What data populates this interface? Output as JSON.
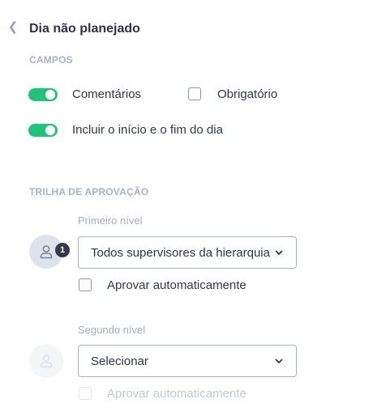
{
  "header": {
    "back_icon": "chevron-left-icon",
    "title": "Dia não planejado"
  },
  "campos": {
    "section_label": "CAMPOS",
    "comentarios": {
      "label": "Comentários",
      "toggle_on": true
    },
    "obrigatorio": {
      "label": "Obrigatório",
      "checked": false
    },
    "incluir": {
      "label": "Incluir o início e o fim do dia",
      "toggle_on": true
    }
  },
  "trilha": {
    "section_label": "TRILHA DE APROVAÇÃO",
    "levels": [
      {
        "label": "Primeiro nível",
        "badge": "1",
        "avatar_icon": "user-icon",
        "select_value": "Todos supervisores da hierarquia",
        "auto_approve_label": "Aprovar automaticamente",
        "auto_approve_checked": false,
        "disabled": false
      },
      {
        "label": "Segundo nível",
        "avatar_icon": "user-icon",
        "select_value": "Selecionar",
        "auto_approve_label": "Aprovar automaticamente",
        "auto_approve_checked": false,
        "disabled": true
      }
    ]
  },
  "colors": {
    "toggle_on": "#1fc47a",
    "text": "#2b3446",
    "muted": "#a8b2c6",
    "badge": "#323b4c"
  }
}
